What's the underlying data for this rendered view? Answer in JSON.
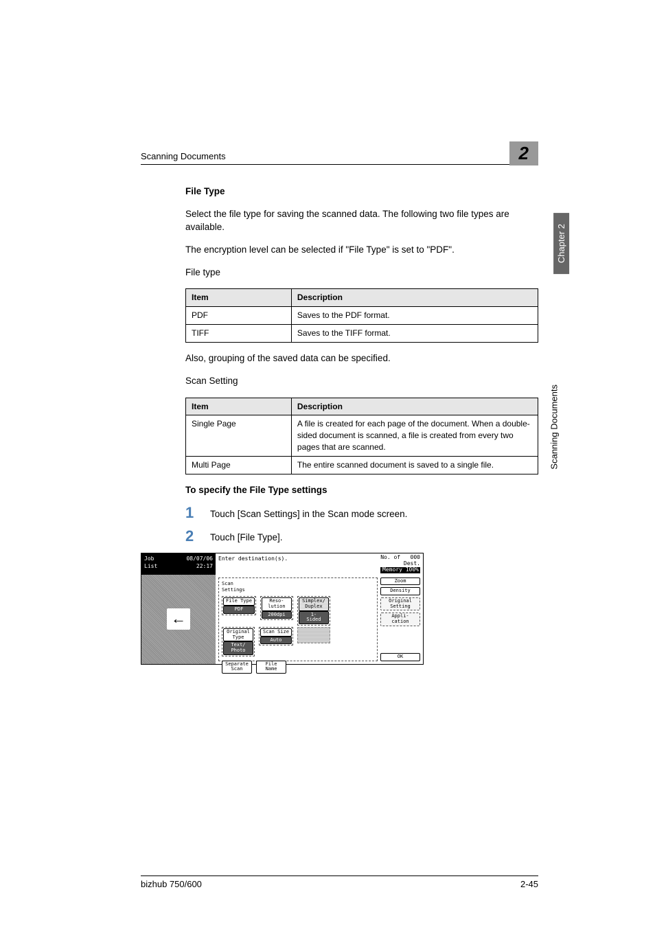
{
  "header": {
    "running_title": "Scanning Documents",
    "chapter_number": "2"
  },
  "sidebar": {
    "tab_label": "Chapter 2",
    "vertical_text": "Scanning Documents"
  },
  "body": {
    "section_title": "File Type",
    "p1": "Select the file type for saving the scanned data. The following two file types are available.",
    "p2": "The encryption level can be selected if \"File Type\" is set to \"PDF\".",
    "label_file_type": "File type",
    "table1": {
      "h_item": "Item",
      "h_desc": "Description",
      "rows": [
        {
          "item": "PDF",
          "desc": "Saves to the PDF format."
        },
        {
          "item": "TIFF",
          "desc": "Saves to the TIFF format."
        }
      ]
    },
    "p3": "Also, grouping of the saved data can be specified.",
    "label_scan_setting": "Scan Setting",
    "table2": {
      "h_item": "Item",
      "h_desc": "Description",
      "rows": [
        {
          "item": "Single Page",
          "desc": "A file is created for each page of the document. When a double-sided document is scanned, a file is created from every two pages that are scanned."
        },
        {
          "item": "Multi Page",
          "desc": "The entire scanned document is saved to a single file."
        }
      ]
    },
    "subheading": "To specify the File Type settings",
    "steps": [
      {
        "num": "1",
        "text": "Touch [Scan Settings] in the Scan mode screen."
      },
      {
        "num": "2",
        "text": "Touch [File Type]."
      }
    ]
  },
  "screen": {
    "job_list": "Job\nList",
    "datetime": "08/07/06\n22:17",
    "prompt": "Enter destination(s).",
    "no_of": "No. of",
    "dest": "Dest.",
    "dest_count": "000",
    "memory": "Memory 100%",
    "settings_label": "Scan\nSettings",
    "buttons": {
      "file_type": "File Type",
      "file_type_val": "PDF",
      "resolution": "Reso-\nlution",
      "resolution_val": "200dpi",
      "simplex": "Simplex/\nDuplex",
      "simplex_val": "1-\nSided",
      "original_type": "Original\nType",
      "original_type_val": "Text/\nPhoto",
      "scan_size": "Scan Size",
      "scan_size_val": "Auto",
      "separate_scan": "Separate\nScan",
      "file_name": "File\nName",
      "zoom": "Zoom",
      "density": "Density",
      "original_setting": "Original\nSetting",
      "application": "Appli-\ncation",
      "ok": "OK"
    },
    "arrow": "←"
  },
  "footer": {
    "model": "bizhub 750/600",
    "page": "2-45"
  }
}
